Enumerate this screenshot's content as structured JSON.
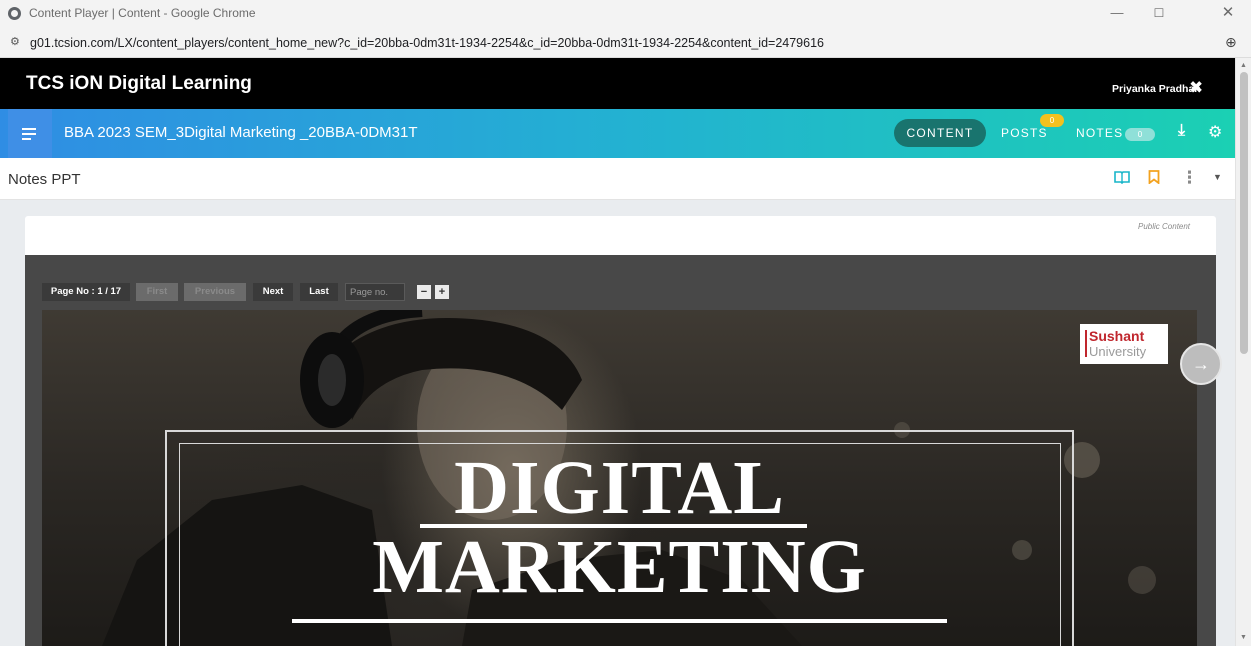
{
  "browser": {
    "window_title": "Content Player | Content - Google Chrome",
    "url": "g01.tcsion.com/LX/content_players/content_home_new?c_id=20bba-0dm31t-1934-2254&c_id=20bba-0dm31t-1934-2254&content_id=2479616",
    "minimize_glyph": "—",
    "maximize_glyph": "☐",
    "close_glyph": "✕",
    "site_info_glyph": "⚙",
    "zoom_glyph": "⊕"
  },
  "header": {
    "brand": "TCS iON Digital Learning",
    "user_name": "Priyanka Pradhan",
    "logout_glyph": "✖"
  },
  "coursebar": {
    "course_title": "BBA 2023 SEM_3Digital Marketing _20BBA-0DM31T",
    "content_label": "CONTENT",
    "posts_label": "POSTS",
    "posts_count": "0",
    "notes_label": "NOTES",
    "notes_count": "0",
    "download_glyph": "⤓",
    "settings_glyph": "⚙"
  },
  "notesbar": {
    "title": "Notes PPT",
    "more_glyph": "⋮",
    "caret_glyph": "▼"
  },
  "card": {
    "visibility": "Public Content"
  },
  "player": {
    "page_indicator": "Page No : 1 / 17",
    "first_label": "First",
    "previous_label": "Previous",
    "next_label": "Next",
    "last_label": "Last",
    "page_input_placeholder": "Page no.",
    "zoom_out": "−",
    "zoom_in": "+",
    "next_slide_glyph": "→"
  },
  "slide": {
    "title_line1": "DIGITAL",
    "title_line2": "MARKETING",
    "logo_line1": "Sushant",
    "logo_line2": "University"
  },
  "colors": {
    "header_bg": "#000000",
    "coursebar_start": "#2f8de4",
    "coursebar_end": "#1bd0b3",
    "content_pill": "#19746e",
    "posts_badge": "#f3c11f",
    "icon_accent": "#19b5c9",
    "bookmark_accent": "#f3a21f",
    "logo_red": "#c0262d"
  }
}
